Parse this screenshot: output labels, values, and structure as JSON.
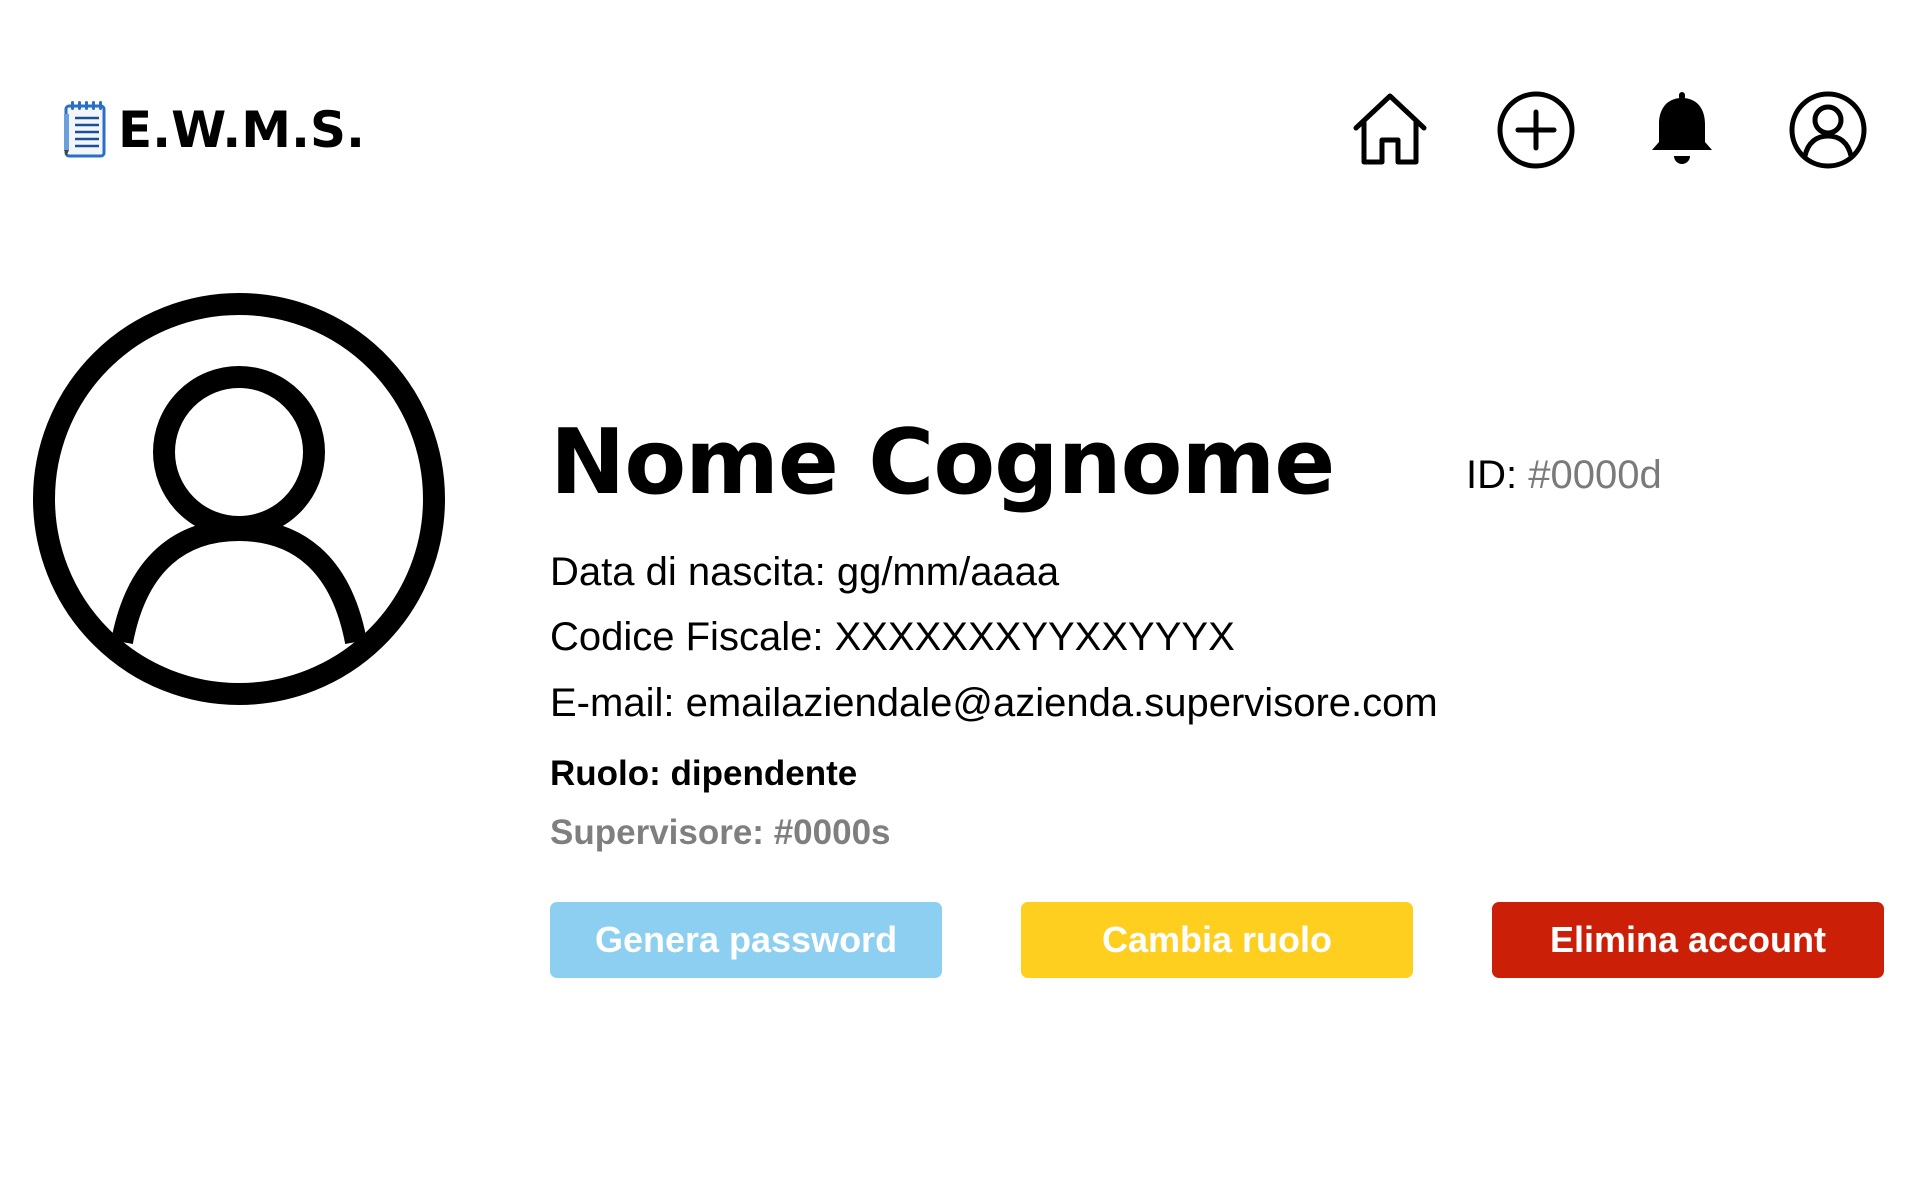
{
  "header": {
    "logo_text": "E.W.M.S.",
    "logo_icon": "notepad-icon",
    "nav": [
      {
        "icon": "home-icon"
      },
      {
        "icon": "add-circle-icon"
      },
      {
        "icon": "bell-icon"
      },
      {
        "icon": "user-circle-icon"
      }
    ]
  },
  "profile": {
    "avatar_icon": "user-avatar-icon",
    "name": "Nome Cognome",
    "id_label": "ID:",
    "id_value": "#0000d",
    "birth_label": "Data di nascita:",
    "birth_value": "gg/mm/aaaa",
    "cf_label": "Codice Fiscale:",
    "cf_value": "XXXXXXXYYXXYYYX",
    "email_label": "E-mail:",
    "email_value": "emailaziendale@azienda.supervisore.com",
    "ruolo_label": "Ruolo:",
    "ruolo_value": "dipendente",
    "supervisore_label": "Supervisore:",
    "supervisore_value": "#0000s"
  },
  "actions": {
    "genera_password": "Genera password",
    "cambia_ruolo": "Cambia ruolo",
    "elimina_account": "Elimina account"
  },
  "colors": {
    "genera_password": "#8ccff0",
    "cambia_ruolo": "#fecf1f",
    "elimina_account": "#cc1f08",
    "muted_text": "#7f7f7f"
  }
}
